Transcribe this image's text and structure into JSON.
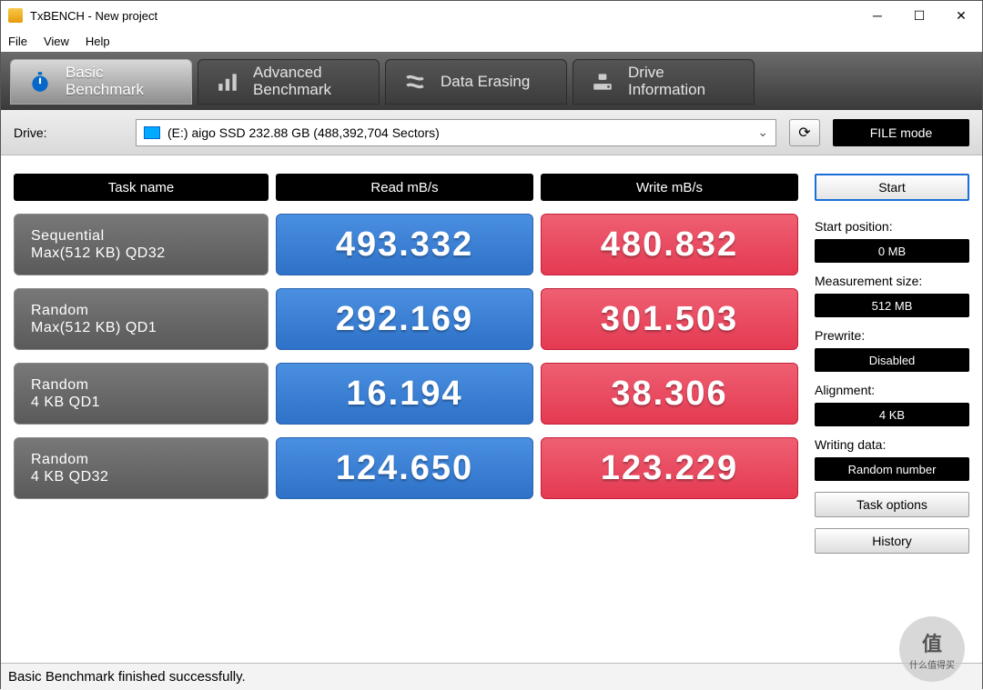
{
  "window": {
    "title": "TxBENCH - New project"
  },
  "menu": {
    "file": "File",
    "view": "View",
    "help": "Help"
  },
  "tabs": {
    "basic": {
      "l1": "Basic",
      "l2": "Benchmark"
    },
    "advanced": {
      "l1": "Advanced",
      "l2": "Benchmark"
    },
    "erase": {
      "l1": "Data Erasing"
    },
    "drive": {
      "l1": "Drive",
      "l2": "Information"
    }
  },
  "drive": {
    "label": "Drive:",
    "selected": "(E:) aigo SSD  232.88 GB (488,392,704 Sectors)",
    "mode_button": "FILE mode"
  },
  "headers": {
    "task": "Task name",
    "read": "Read mB/s",
    "write": "Write mB/s"
  },
  "rows": [
    {
      "t1": "Sequential",
      "t2": "Max(512 KB) QD32",
      "read": "493.332",
      "write": "480.832"
    },
    {
      "t1": "Random",
      "t2": "Max(512 KB) QD1",
      "read": "292.169",
      "write": "301.503"
    },
    {
      "t1": "Random",
      "t2": "4 KB QD1",
      "read": "16.194",
      "write": "38.306"
    },
    {
      "t1": "Random",
      "t2": "4 KB QD32",
      "read": "124.650",
      "write": "123.229"
    }
  ],
  "side": {
    "start": "Start",
    "start_pos_label": "Start position:",
    "start_pos": "0 MB",
    "meas_label": "Measurement size:",
    "meas": "512 MB",
    "prewrite_label": "Prewrite:",
    "prewrite": "Disabled",
    "align_label": "Alignment:",
    "align": "4 KB",
    "wdata_label": "Writing data:",
    "wdata": "Random number",
    "task_options": "Task options",
    "history": "History"
  },
  "status": "Basic Benchmark finished successfully.",
  "watermark": {
    "char": "值",
    "text": "什么值得买"
  }
}
